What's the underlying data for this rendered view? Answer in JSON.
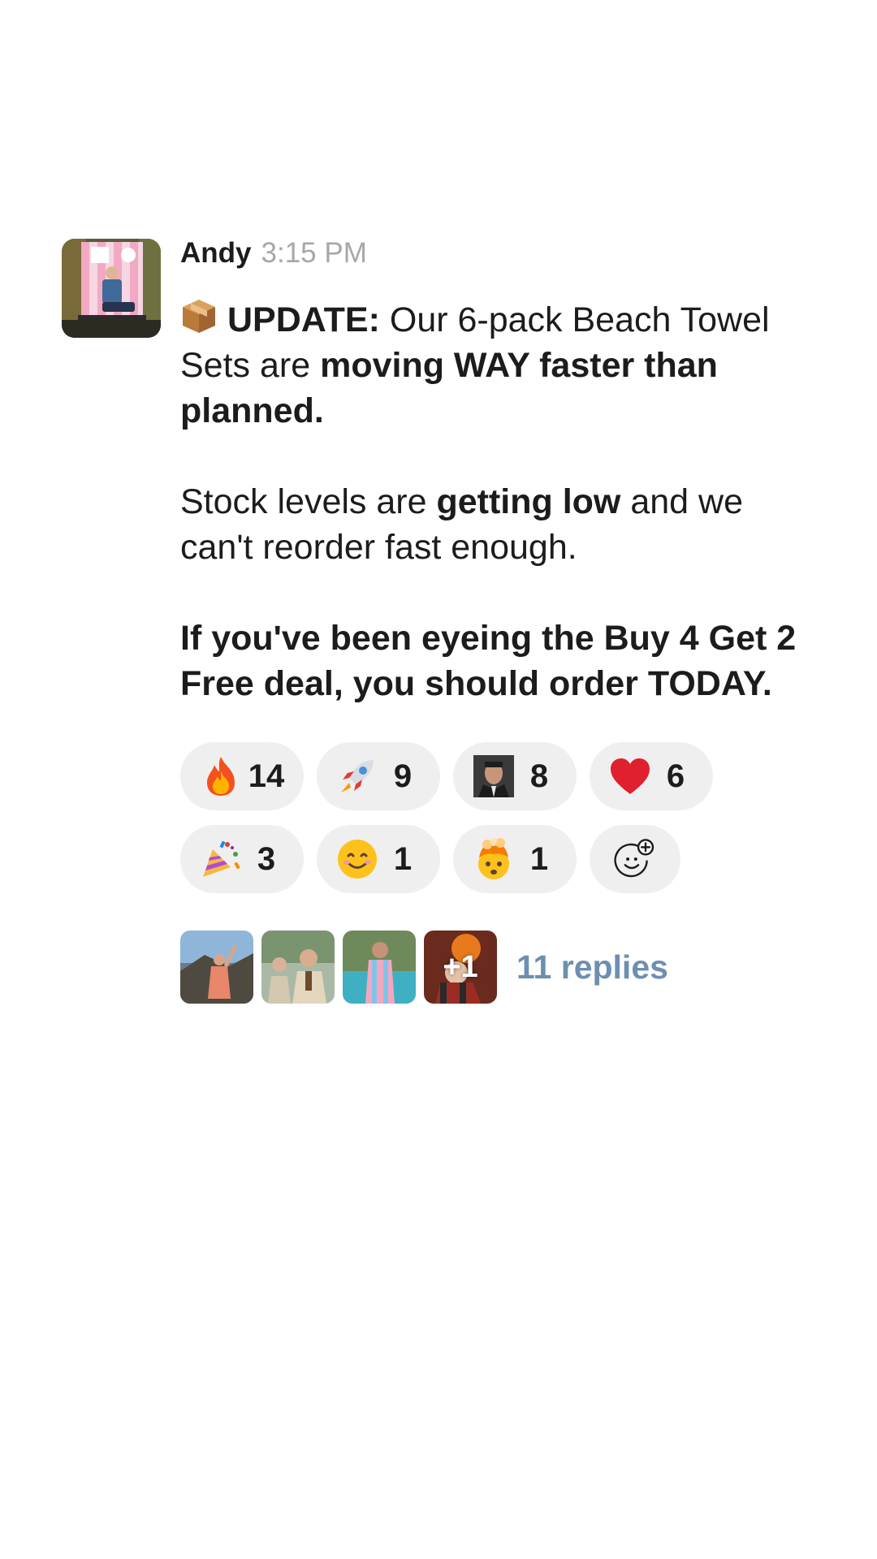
{
  "message": {
    "author": "Andy",
    "time": "3:15 PM",
    "avatar_icon": "user-avatar-beach-chair",
    "paragraphs": [
      {
        "segments": [
          {
            "text": "UPDATE:",
            "bold": true
          },
          {
            "text": " Our 6-pack Beach Towel Sets are ",
            "bold": false
          },
          {
            "text": "moving WAY faster than planned.",
            "bold": true
          }
        ],
        "leading_icon": "package-emoji"
      },
      {
        "segments": [
          {
            "text": "Stock levels are ",
            "bold": false
          },
          {
            "text": "getting low",
            "bold": true
          },
          {
            "text": " and we can't reorder fast enough.",
            "bold": false
          }
        ]
      },
      {
        "segments": [
          {
            "text": "If you've been eyeing the Buy 4 Get 2 Free deal, you should order TODAY.",
            "bold": true
          }
        ]
      }
    ]
  },
  "reactions": [
    {
      "icon": "fire-emoji",
      "count": "14"
    },
    {
      "icon": "rocket-emoji",
      "count": "9"
    },
    {
      "icon": "custom-face-emoji",
      "count": "8"
    },
    {
      "icon": "red-heart-emoji",
      "count": "6"
    },
    {
      "icon": "party-popper-emoji",
      "count": "3"
    },
    {
      "icon": "smiling-face-emoji",
      "count": "1"
    },
    {
      "icon": "exploding-head-emoji",
      "count": "1"
    }
  ],
  "add_reaction_icon": "add-reaction-icon",
  "thread": {
    "participants": [
      "participant-avatar-1",
      "participant-avatar-2",
      "participant-avatar-3",
      "participant-avatar-4"
    ],
    "extra_count": "+1",
    "replies_label": "11 replies"
  },
  "colors": {
    "replies_link": "#6d8fb0",
    "pill_background": "#efefef",
    "timestamp": "#a7a7a7"
  }
}
